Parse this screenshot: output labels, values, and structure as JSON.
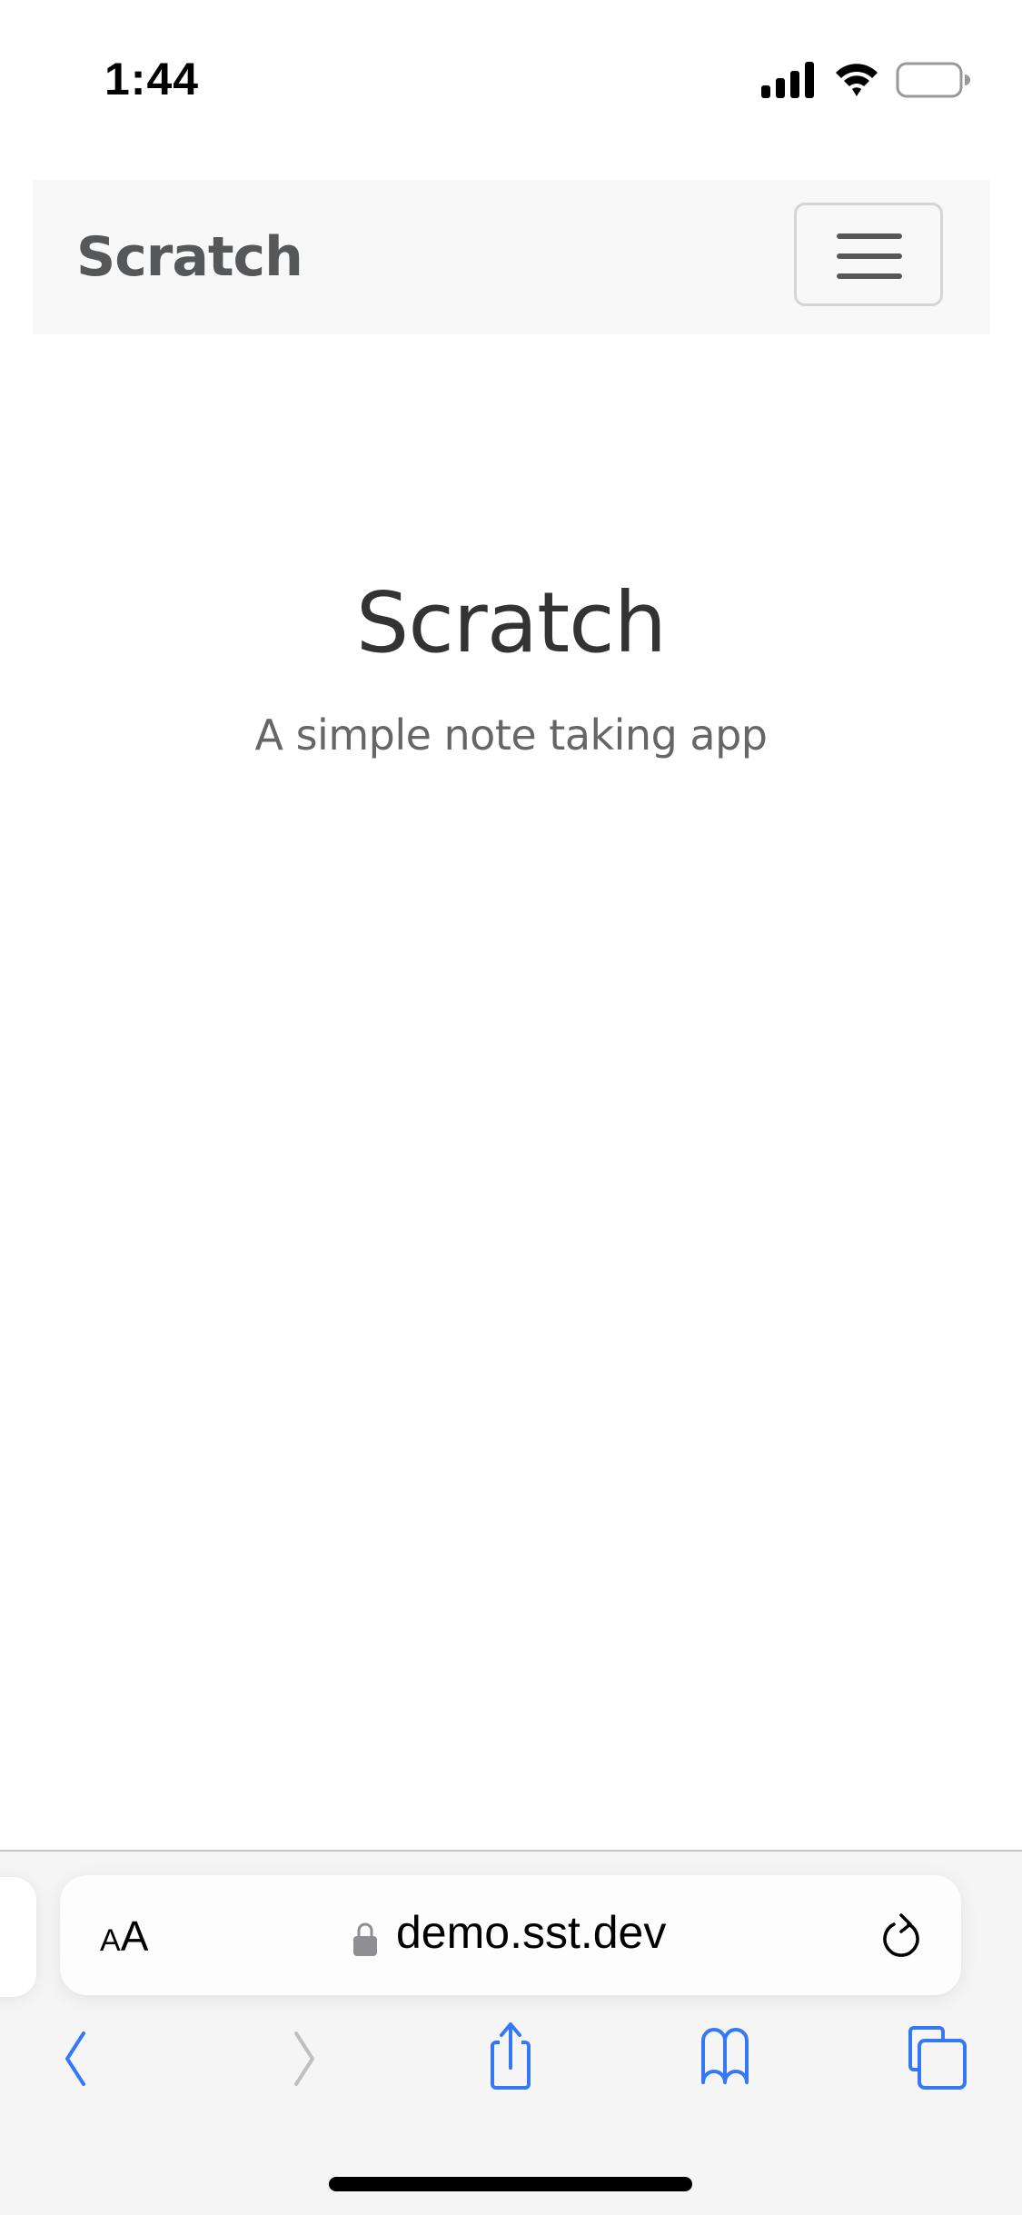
{
  "status_bar": {
    "time": "1:44",
    "icons": [
      "cellular-signal-icon",
      "wifi-icon",
      "battery-icon"
    ]
  },
  "navbar": {
    "brand": "Scratch",
    "menu_toggle_icon": "hamburger-icon"
  },
  "hero": {
    "title": "Scratch",
    "subtitle": "A simple note taking app"
  },
  "browser": {
    "text_size_label_small": "A",
    "text_size_label_large": "A",
    "url": "demo.sst.dev",
    "secure_icon": "lock-icon",
    "reload_icon": "reload-icon",
    "toolbar": [
      {
        "name": "back",
        "icon": "chevron-left-icon",
        "enabled": true
      },
      {
        "name": "forward",
        "icon": "chevron-right-icon",
        "enabled": false
      },
      {
        "name": "share",
        "icon": "share-icon",
        "enabled": true
      },
      {
        "name": "bookmarks",
        "icon": "book-icon",
        "enabled": true
      },
      {
        "name": "tabs",
        "icon": "tabs-icon",
        "enabled": true
      }
    ],
    "accent_color": "#3478f6",
    "disabled_color": "#bfbfbf"
  }
}
